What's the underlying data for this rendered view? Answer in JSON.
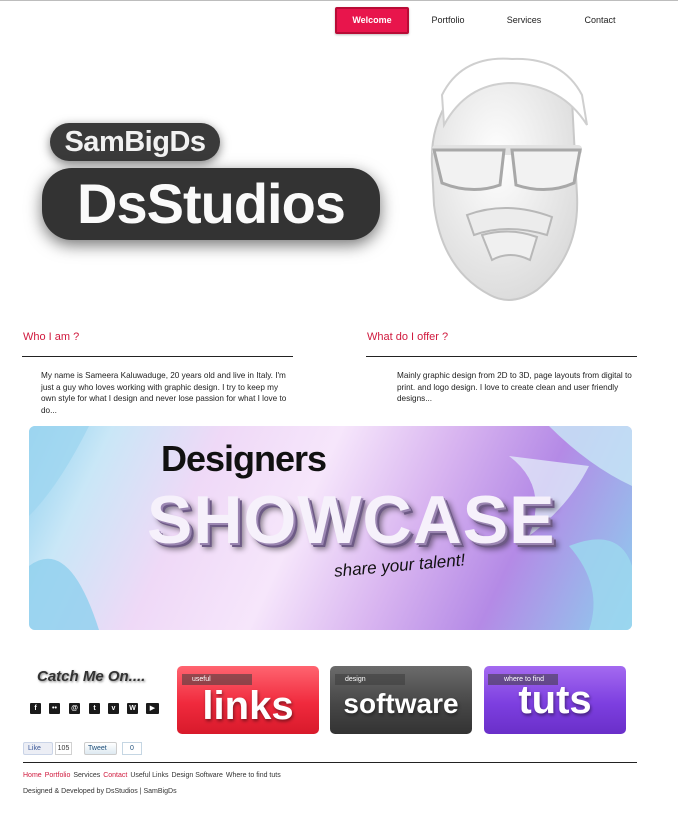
{
  "nav": {
    "items": [
      {
        "label": "Welcome",
        "active": true
      },
      {
        "label": "Portfolio",
        "active": false
      },
      {
        "label": "Services",
        "active": false
      },
      {
        "label": "Contact",
        "active": false
      }
    ]
  },
  "hero": {
    "logo_small": "SamBigDs",
    "logo_big": "DsStudios"
  },
  "about": {
    "who_title": "Who I am ?",
    "who_text": "My name is Sameera Kaluwaduge, 20 years old and live in Italy. I'm just a guy who loves working with graphic design. I try to keep my own style for what I design and never lose passion for what I love to do...",
    "offer_title": "What do I offer ?",
    "offer_text": "Mainly graphic design from 2D to 3D, page layouts from digital to print. and logo design. I love to create clean and user friendly designs..."
  },
  "showcase": {
    "line1": "Designers",
    "line2": "SHOWCASE",
    "tagline": "share your talent!"
  },
  "catch_me": {
    "title": "Catch Me On....",
    "icons": [
      "facebook-icon",
      "flickr-icon",
      "at-sign-icon",
      "twitter-icon",
      "vimeo-icon",
      "wordpress-icon",
      "youtube-icon"
    ]
  },
  "tiles": [
    {
      "small": "useful",
      "big": "links",
      "color": "#f02a3d"
    },
    {
      "small": "design",
      "big": "software",
      "color": "#474747"
    },
    {
      "small": "where to find",
      "big": "tuts",
      "color": "#7d3fe0"
    }
  ],
  "social_buttons": {
    "like_label": "Like",
    "like_count": "105",
    "tweet_label": "Tweet",
    "tweet_count": "0"
  },
  "footer": {
    "links": [
      {
        "label": "Home",
        "color": "red"
      },
      {
        "label": "Portfolio",
        "color": "red"
      },
      {
        "label": "Services",
        "color": "dark"
      },
      {
        "label": "Contact",
        "color": "red"
      },
      {
        "label": "Useful Links",
        "color": "dark"
      },
      {
        "label": "Design Software",
        "color": "dark"
      },
      {
        "label": "Where to find tuts",
        "color": "dark"
      }
    ],
    "credits": "Designed & Developed by DsStudios | SamBigDs"
  },
  "colors": {
    "accent": "#e8154c",
    "heading": "#d0193d"
  }
}
